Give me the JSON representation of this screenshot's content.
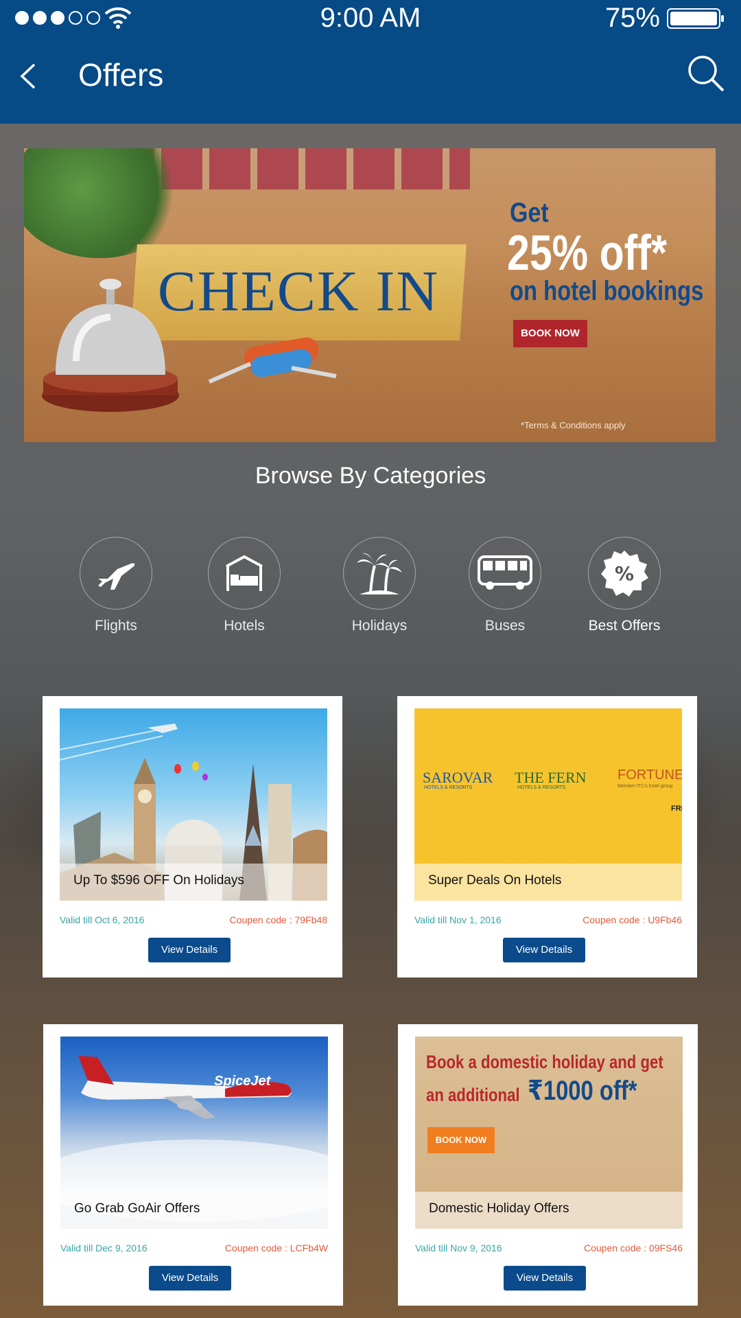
{
  "status_bar": {
    "time": "9:00 AM",
    "battery": "75%"
  },
  "header": {
    "title": "Offers"
  },
  "banner": {
    "sign_text": "CHECK IN",
    "line1": "Get",
    "line2": "25% off*",
    "line3": "on hotel bookings",
    "button": "BOOK NOW",
    "terms": "*Terms & Conditions apply"
  },
  "browse": {
    "title": "Browse By Categories",
    "categories": [
      {
        "label": "Flights",
        "icon": "airplane-icon"
      },
      {
        "label": "Hotels",
        "icon": "hotel-bed-icon"
      },
      {
        "label": "Holidays",
        "icon": "palm-tree-icon"
      },
      {
        "label": "Buses",
        "icon": "bus-icon"
      },
      {
        "label": "Best Offers",
        "icon": "percent-badge-icon"
      }
    ]
  },
  "offers": [
    {
      "caption": "Up To $596 OFF On Holidays",
      "valid": "Valid till Oct 6, 2016",
      "coupon": "Coupen code : 79Fb48",
      "button": "View Details"
    },
    {
      "caption": "Super Deals On Hotels",
      "valid": "Valid till Nov 1, 2016",
      "coupon": "Coupen code : U9Fb46",
      "button": "View Details",
      "brands": [
        "SAROVAR",
        "HOTELS & RESORTS",
        "THE FERN",
        "HOTELS & RESORTS",
        "FORTUNE",
        "Member ITC's hotel group",
        "FRE"
      ]
    },
    {
      "caption": "Go Grab GoAir Offers",
      "valid": "Valid till Dec 9, 2016",
      "coupon": "Coupen code : LCFb4W",
      "button": "View Details",
      "brand": "SpiceJet"
    },
    {
      "caption": "Domestic Holiday Offers",
      "valid": "Valid till Nov 9, 2016",
      "coupon": "Coupen code : 09FS46",
      "button": "View Details",
      "promo_line1": "Book a domestic holiday and get",
      "promo_line2a": "an additional",
      "promo_line2b": "₹1000 off*",
      "promo_button": "BOOK NOW"
    }
  ]
}
